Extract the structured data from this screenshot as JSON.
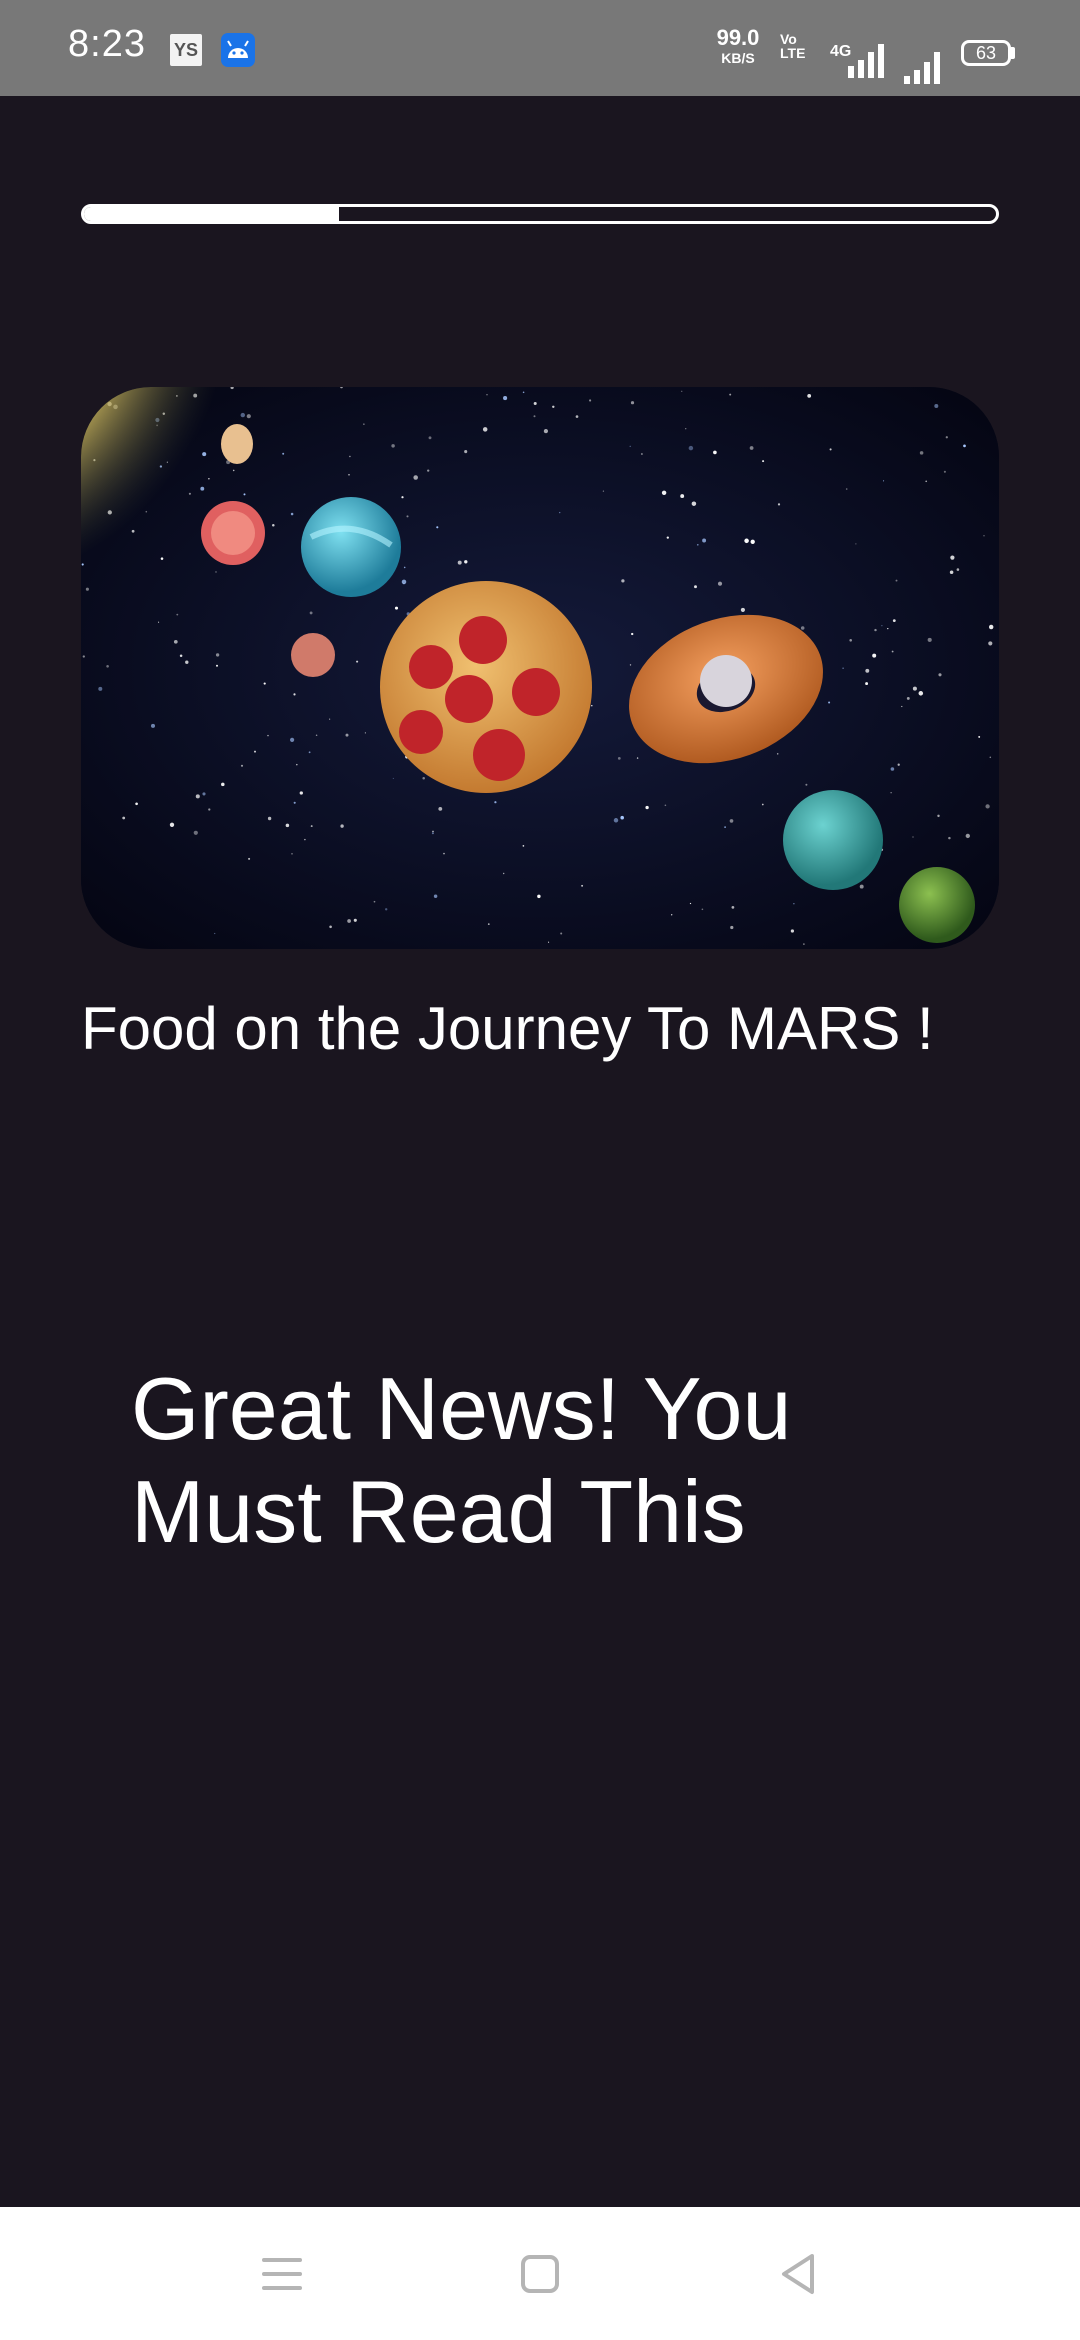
{
  "status_bar": {
    "time": "8:23",
    "notification_icons": [
      "ys-app-icon",
      "android-icon"
    ],
    "ys_label": "YS",
    "net_speed_value": "99.0",
    "net_speed_unit": "KB/S",
    "volte_top": "Vo",
    "volte_bottom": "LTE",
    "network_type": "4G",
    "battery": "63"
  },
  "story": {
    "progress_percent": 28,
    "image_icon": "space-food-image",
    "caption": "Food on the Journey To MARS !",
    "headline": "Great News! You Must Read This"
  },
  "nav_bar": {
    "buttons": [
      "menu-icon",
      "home-icon",
      "back-icon"
    ]
  },
  "colors": {
    "background": "#1a151f",
    "status_bar": "#787878",
    "text": "#ffffff",
    "nav_bar": "#ffffff",
    "nav_icon": "#b5b5b5"
  }
}
